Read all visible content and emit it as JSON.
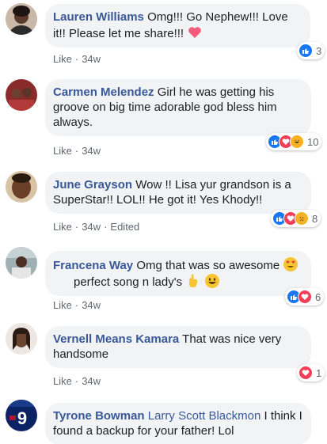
{
  "comments": [
    {
      "author": "Lauren Williams",
      "text": "Omg!!! Go Nephew!!! Love it!! Please let me share!!!",
      "trailing_emoji": "heart-emoji",
      "like": "Like",
      "time": "34w",
      "reactions": [
        "like"
      ],
      "reaction_count": "3"
    },
    {
      "author": "Carmen Melendez",
      "text": "Girl he was getting his groove on big time adorable god bless him always.",
      "like": "Like",
      "time": "34w",
      "reactions": [
        "like",
        "love",
        "haha"
      ],
      "reaction_count": "10"
    },
    {
      "author": "June Grayson",
      "text": "Wow !! Lisa yur grandson is a SuperStar!! LOL!! He got it! Yes Khody!!",
      "like": "Like",
      "time": "34w",
      "edited": "Edited",
      "reactions": [
        "like",
        "love",
        "sad"
      ],
      "reaction_count": "8"
    },
    {
      "author": "Francena Way",
      "text_line1": "Omg that was so awesome",
      "text_line2": "perfect song n lady's",
      "like": "Like",
      "time": "34w",
      "reactions": [
        "like",
        "love"
      ],
      "reaction_count": "6"
    },
    {
      "author": "Vernell Means Kamara",
      "text": "That was nice very handsome",
      "like": "Like",
      "time": "34w",
      "reactions": [
        "love"
      ],
      "reaction_count": "1"
    },
    {
      "author": "Tyrone Bowman",
      "mention": "Larry Scott Blackmon",
      "text": "I think I found a backup for your father! Lol"
    }
  ],
  "colors": {
    "author": "#385898",
    "bubble": "#f2f3f5",
    "meta": "#606770",
    "like_reaction": "#1877f2",
    "love_reaction": "#f33e58"
  }
}
